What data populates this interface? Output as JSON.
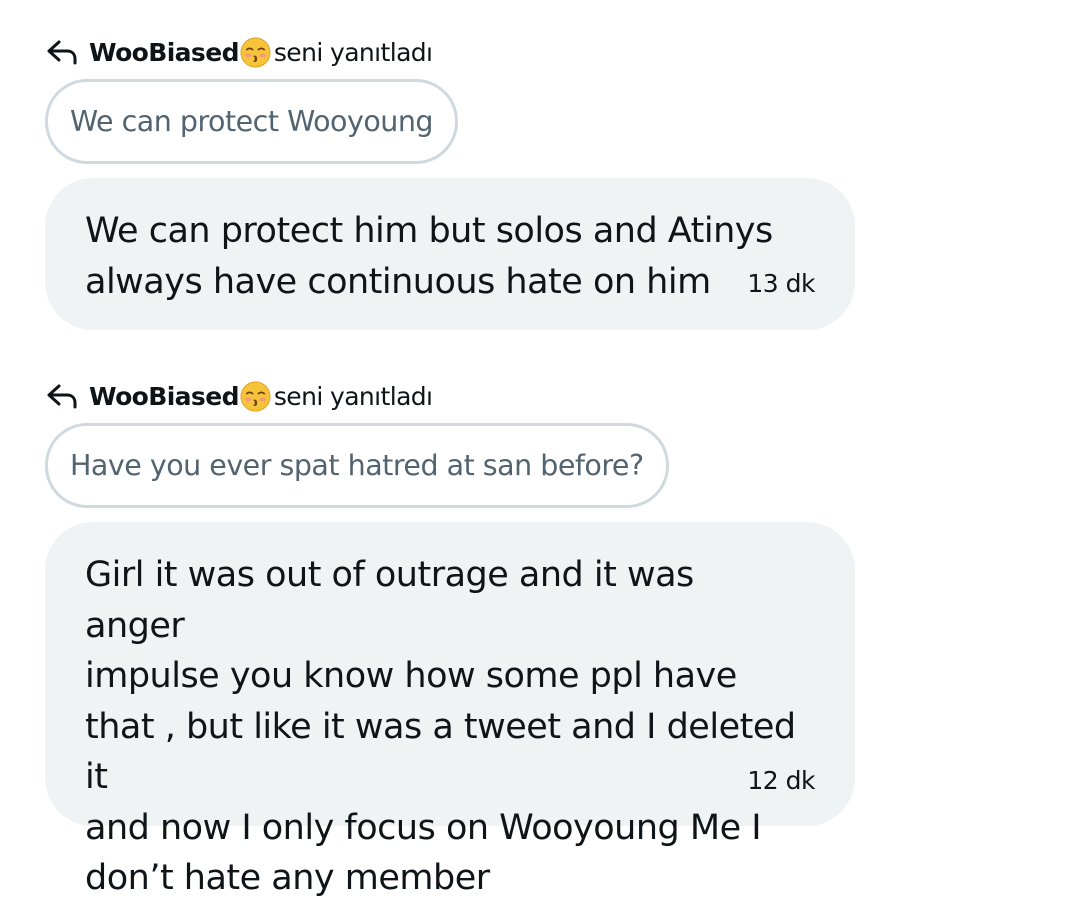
{
  "conversation": [
    {
      "reply_user": "WooBiased",
      "reply_emoji": "kissing-face-with-closed-eyes",
      "reply_action": "seni yanıtladı",
      "quoted_message": "We can protect Wooyoung",
      "message": "We can protect him but solos and Atinys\nalways have continuous hate on him",
      "time": "13 dk"
    },
    {
      "reply_user": "WooBiased",
      "reply_emoji": "kissing-face-with-closed-eyes",
      "reply_action": "seni yanıtladı",
      "quoted_message": "Have you ever spat hatred at san before?",
      "message": "Girl it was out of outrage and it was anger\nimpulse you know how some ppl have\nthat , but like it was a tweet and I deleted it\nand now I only focus on Wooyoung Me I\ndon’t hate any member",
      "time": "12 dk"
    }
  ],
  "colors": {
    "bubble_background": "#eff3f4",
    "quote_border": "#cfd9de",
    "quote_text": "#536471",
    "primary_text": "#0f1419"
  }
}
